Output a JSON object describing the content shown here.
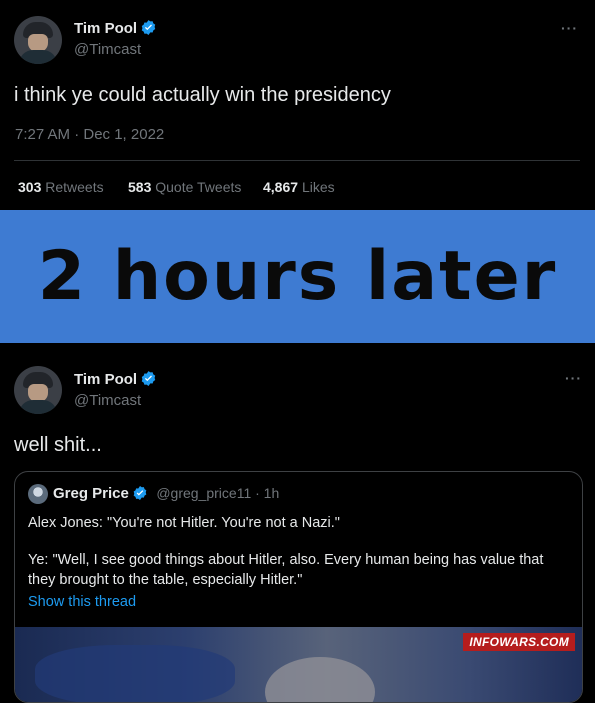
{
  "tweet1": {
    "name": "Tim Pool",
    "handle": "@Timcast",
    "more": "···",
    "text": "i think ye could actually win the presidency",
    "timestamp": "7:27 AM · Dec 1, 2022",
    "stats": [
      {
        "count": "303",
        "label": "Retweets"
      },
      {
        "count": "583",
        "label": "Quote Tweets"
      },
      {
        "count": "4,867",
        "label": "Likes"
      }
    ]
  },
  "banner": {
    "text": "2 hours later",
    "color": "#3e7bd2"
  },
  "tweet2": {
    "name": "Tim Pool",
    "handle": "@Timcast",
    "more": "···",
    "text": "well shit...",
    "quote": {
      "name": "Greg Price",
      "handle": "@greg_price11 · 1h",
      "line1": "Alex Jones: \"You're not Hitler. You're not a Nazi.\"",
      "line2": "Ye: \"Well, I see good things about Hitler, also. Every human being has value that they brought to the table, especially Hitler.\"",
      "link": "Show this thread",
      "media_badge": "INFOWARS.COM"
    }
  },
  "colors": {
    "accent": "#1d9bf0",
    "background": "#000000",
    "muted": "#71767b"
  }
}
